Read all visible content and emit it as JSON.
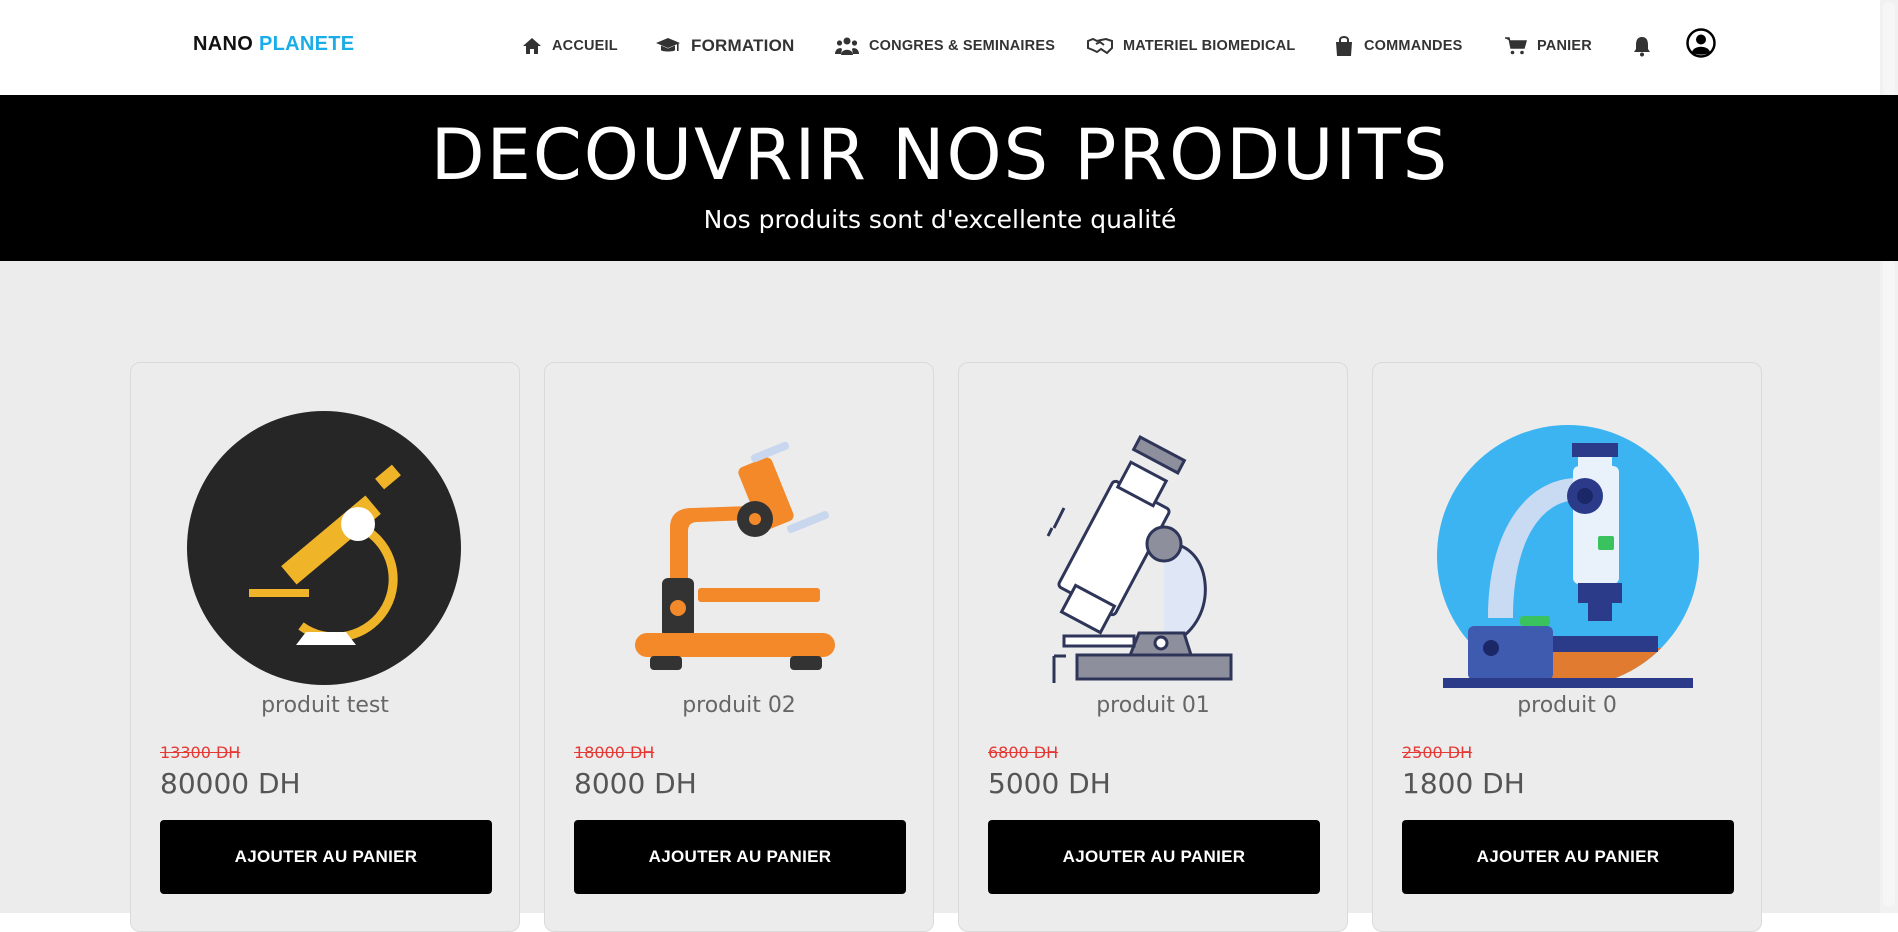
{
  "brand": {
    "part1": "NANO",
    "part2": "PLANETE"
  },
  "nav": {
    "accueil": "ACCUEIL",
    "formation": "FORMATION",
    "congres": "CONGRES & SEMINAIRES",
    "materiel": "MATERIEL BIOMEDICAL",
    "commandes": "COMMANDES",
    "panier": "PANIER"
  },
  "hero": {
    "title": "DECOUVRIR NOS PRODUITS",
    "subtitle": "Nos produits sont d'excellente qualité"
  },
  "products": [
    {
      "name": "produit test",
      "old_price": "13300 DH",
      "price": "80000 DH",
      "button": "AJOUTER AU PANIER",
      "icon": "microscope-dark-circle-icon"
    },
    {
      "name": "produit 02",
      "old_price": "18000 DH",
      "price": "8000 DH",
      "button": "AJOUTER AU PANIER",
      "icon": "microscope-orange-icon"
    },
    {
      "name": "produit 01",
      "old_price": "6800 DH",
      "price": "5000 DH",
      "button": "AJOUTER AU PANIER",
      "icon": "microscope-outline-icon"
    },
    {
      "name": "produit 0",
      "old_price": "2500 DH",
      "price": "1800 DH",
      "button": "AJOUTER AU PANIER",
      "icon": "microscope-blue-circle-icon"
    }
  ],
  "colors": {
    "brand_accent": "#1aaee8",
    "hero_bg": "#000000",
    "content_bg": "#ececec",
    "old_price": "#e53935",
    "button_bg": "#000000"
  }
}
